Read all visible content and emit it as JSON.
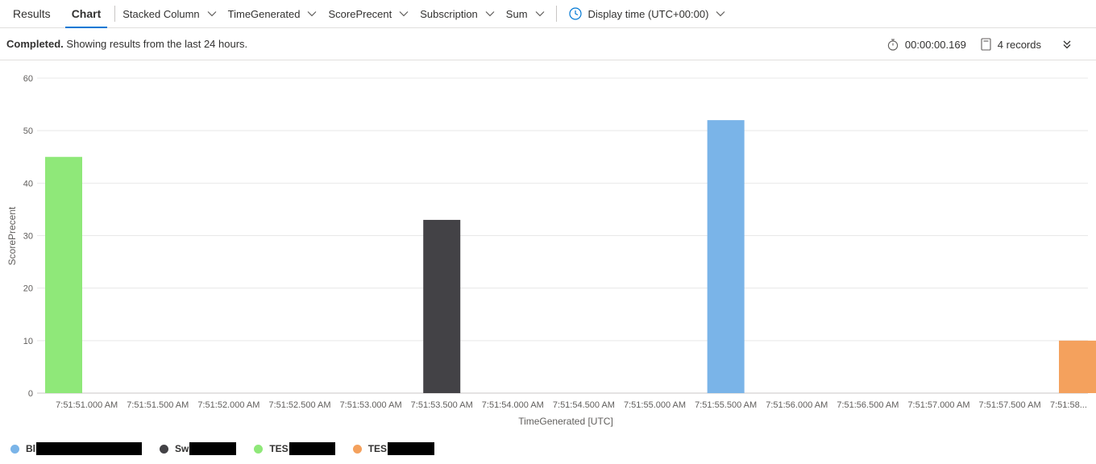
{
  "toolbar": {
    "tabs": [
      {
        "label": "Results",
        "active": false
      },
      {
        "label": "Chart",
        "active": true
      }
    ],
    "chart_type": "Stacked Column",
    "x_column": "TimeGenerated",
    "y_column": "ScorePrecent",
    "split_by": "Subscription",
    "aggregation": "Sum",
    "display_time": "Display time (UTC+00:00)"
  },
  "status": {
    "state": "Completed.",
    "message": "Showing results from the last 24 hours.",
    "duration": "00:00:00.169",
    "records": "4 records"
  },
  "colors": {
    "accent": "#0078d4",
    "series_blue": "#7ab4e8",
    "series_dark": "#434246",
    "series_green": "#8fe879",
    "series_orange": "#f4a15d"
  },
  "chart_data": {
    "type": "bar",
    "stacked": true,
    "xlabel": "TimeGenerated [UTC]",
    "ylabel": "ScorePrecent",
    "ylim": [
      0,
      60
    ],
    "yticks": [
      0,
      10,
      20,
      30,
      40,
      50,
      60
    ],
    "grid": true,
    "legend_position": "bottom-left",
    "x_tick_labels": [
      "7:51:51.000 AM",
      "7:51:51.500 AM",
      "7:51:52.000 AM",
      "7:51:52.500 AM",
      "7:51:53.000 AM",
      "7:51:53.500 AM",
      "7:51:54.000 AM",
      "7:51:54.500 AM",
      "7:51:55.000 AM",
      "7:51:55.500 AM",
      "7:51:56.000 AM",
      "7:51:56.500 AM",
      "7:51:57.000 AM",
      "7:51:57.500 AM",
      "7:51:58..."
    ],
    "series": [
      {
        "name": "Bl",
        "color": "#7ab4e8",
        "x": "7:51:55.500 AM",
        "value": 52
      },
      {
        "name": "Sw",
        "color": "#434246",
        "x": "7:51:53.500 AM",
        "value": 33
      },
      {
        "name": "TES",
        "color": "#8fe879",
        "x": "7:51:50.800 AM",
        "value": 45
      },
      {
        "name": "TES",
        "color": "#f4a15d",
        "x": "7:51:58.000 AM",
        "value": 10
      }
    ]
  }
}
